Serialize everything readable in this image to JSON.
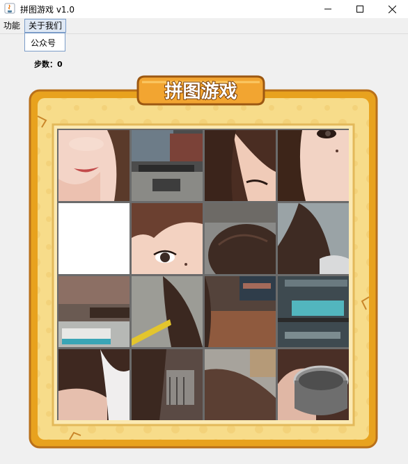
{
  "window": {
    "title": "拼图游戏 v1.0",
    "icon": "java-icon",
    "controls": [
      "minimize-icon",
      "maximize-icon",
      "close-icon"
    ]
  },
  "menu": {
    "items": [
      {
        "label": "功能",
        "expanded": false
      },
      {
        "label": "关于我们",
        "expanded": true
      }
    ],
    "dropdown_items": [
      "公众号"
    ]
  },
  "status": {
    "steps_label": "步数：",
    "steps_value": "0"
  },
  "game": {
    "banner_text": "拼图游戏",
    "grid_size": 4,
    "empty_tile": {
      "row": 1,
      "col": 0
    },
    "tiles": [
      {
        "row": 0,
        "col": 0,
        "content": "smiling-lips"
      },
      {
        "row": 0,
        "col": 1,
        "content": "cafe-background"
      },
      {
        "row": 0,
        "col": 2,
        "content": "hair-and-eye"
      },
      {
        "row": 0,
        "col": 3,
        "content": "eye-and-cheek"
      },
      {
        "row": 1,
        "col": 0,
        "content": "empty"
      },
      {
        "row": 1,
        "col": 1,
        "content": "eye-close-up"
      },
      {
        "row": 1,
        "col": 2,
        "content": "hair-top"
      },
      {
        "row": 1,
        "col": 3,
        "content": "hair-and-shoulder"
      },
      {
        "row": 2,
        "col": 0,
        "content": "cafe-table"
      },
      {
        "row": 2,
        "col": 1,
        "content": "hair-and-yellow-stripe"
      },
      {
        "row": 2,
        "col": 2,
        "content": "wooden-table"
      },
      {
        "row": 2,
        "col": 3,
        "content": "cafe-shelves"
      },
      {
        "row": 3,
        "col": 0,
        "content": "shoulder"
      },
      {
        "row": 3,
        "col": 1,
        "content": "hair-strands"
      },
      {
        "row": 3,
        "col": 2,
        "content": "hair-bottom"
      },
      {
        "row": 3,
        "col": 3,
        "content": "hand-holding-cup"
      }
    ]
  },
  "colors": {
    "frame_outer": "#e8a21e",
    "frame_inner": "#f7dc8a",
    "banner": "#f2a531",
    "grid_line": "#6b6b6b"
  }
}
